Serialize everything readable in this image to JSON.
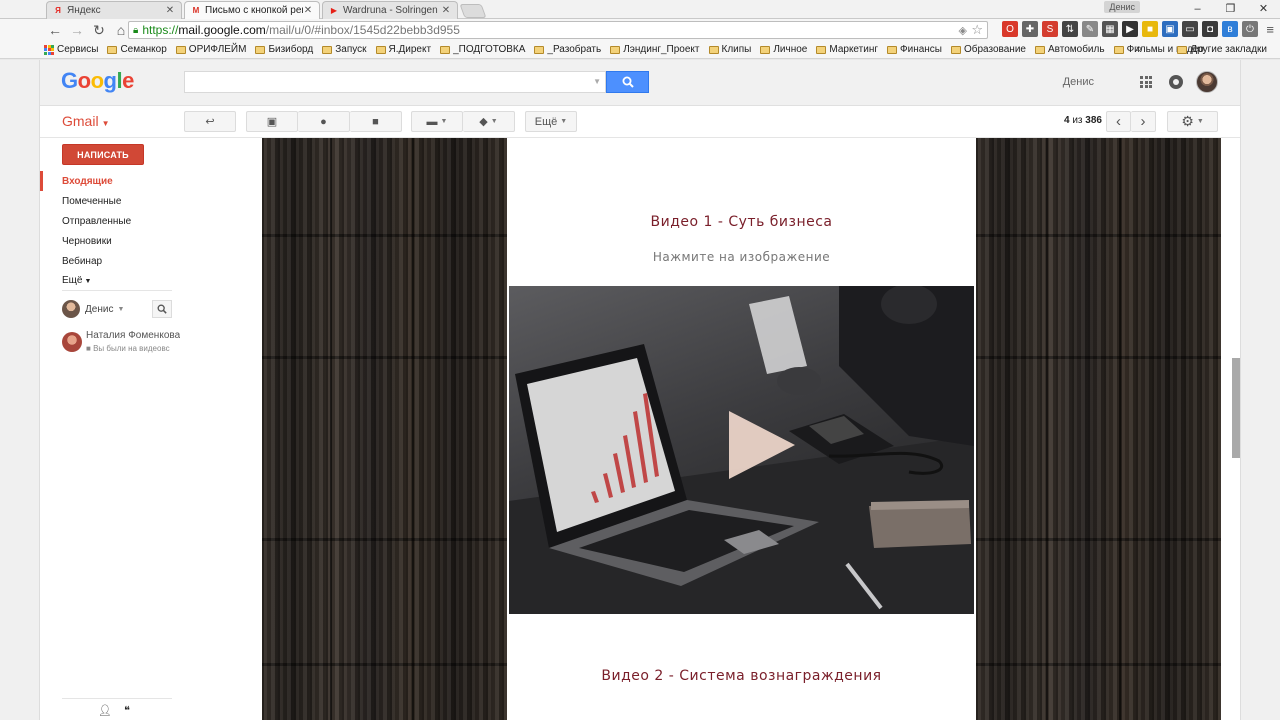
{
  "browser": {
    "tabs": [
      {
        "label": "Яндекс",
        "favicon": "Я",
        "favicon_color": "#e52620",
        "active": false
      },
      {
        "label": "Письмо с кнопкой регис",
        "favicon": "M",
        "favicon_color": "#d93025",
        "active": true
      },
      {
        "label": "Wardruna - Solringen",
        "favicon": "▶",
        "favicon_color": "#e62117",
        "active": false
      }
    ],
    "profile_name": "Денис",
    "window_controls": {
      "minimize": "–",
      "maximize": "❐",
      "close": "✕"
    },
    "url": {
      "scheme": "https://",
      "host": "mail.google.com",
      "path": "/mail/u/0/#inbox/1545d22bebb3d955"
    },
    "bookmarks": [
      "Сервисы",
      "Семанкор",
      "ОРИФЛЕЙМ",
      "Бизиборд",
      "Запуск",
      "Я.Директ",
      "_ПОДГОТОВКА",
      "_Разобрать",
      "Лэндинг_Проект",
      "Клипы",
      "Личное",
      "Маркетинг",
      "Финансы",
      "Образование",
      "Автомобиль",
      "Фильмы и видео"
    ],
    "bookmarks_more": "»",
    "other_bookmarks": "Другие закладки"
  },
  "gmail": {
    "logo": "Google",
    "logo_colors": [
      "#4285f4",
      "#ea4335",
      "#fbbc05",
      "#4285f4",
      "#34a853",
      "#ea4335"
    ],
    "search_placeholder": "",
    "user_name": "Денис",
    "app_label": "Gmail",
    "toolbar": {
      "back_icon": "↩",
      "archive_icon": "▣",
      "spam_icon": "●",
      "delete_icon": "■",
      "move_icon": "▬",
      "labels_icon": "◆",
      "more_label": "Ещё",
      "counter_range": "4",
      "counter_of": "из",
      "counter_total": "386",
      "prev_icon": "‹",
      "next_icon": "›",
      "settings_icon": "⚙"
    },
    "compose_label": "НАПИСАТЬ",
    "nav": [
      {
        "label": "Входящие",
        "active": true
      },
      {
        "label": "Помеченные",
        "active": false
      },
      {
        "label": "Отправленные",
        "active": false
      },
      {
        "label": "Черновики",
        "active": false
      },
      {
        "label": "Вебинар",
        "active": false
      },
      {
        "label": "Ещё",
        "active": false
      }
    ],
    "chat_me": "Денис",
    "contact": {
      "name": "Наталия Фоменкова",
      "status": "Вы были на видеовс"
    }
  },
  "email": {
    "video1_title": "Видео 1 - Суть бизнеса",
    "video1_hint": "Нажмите на изображение",
    "video2_title": "Видео 2 - Система вознаграждения"
  }
}
